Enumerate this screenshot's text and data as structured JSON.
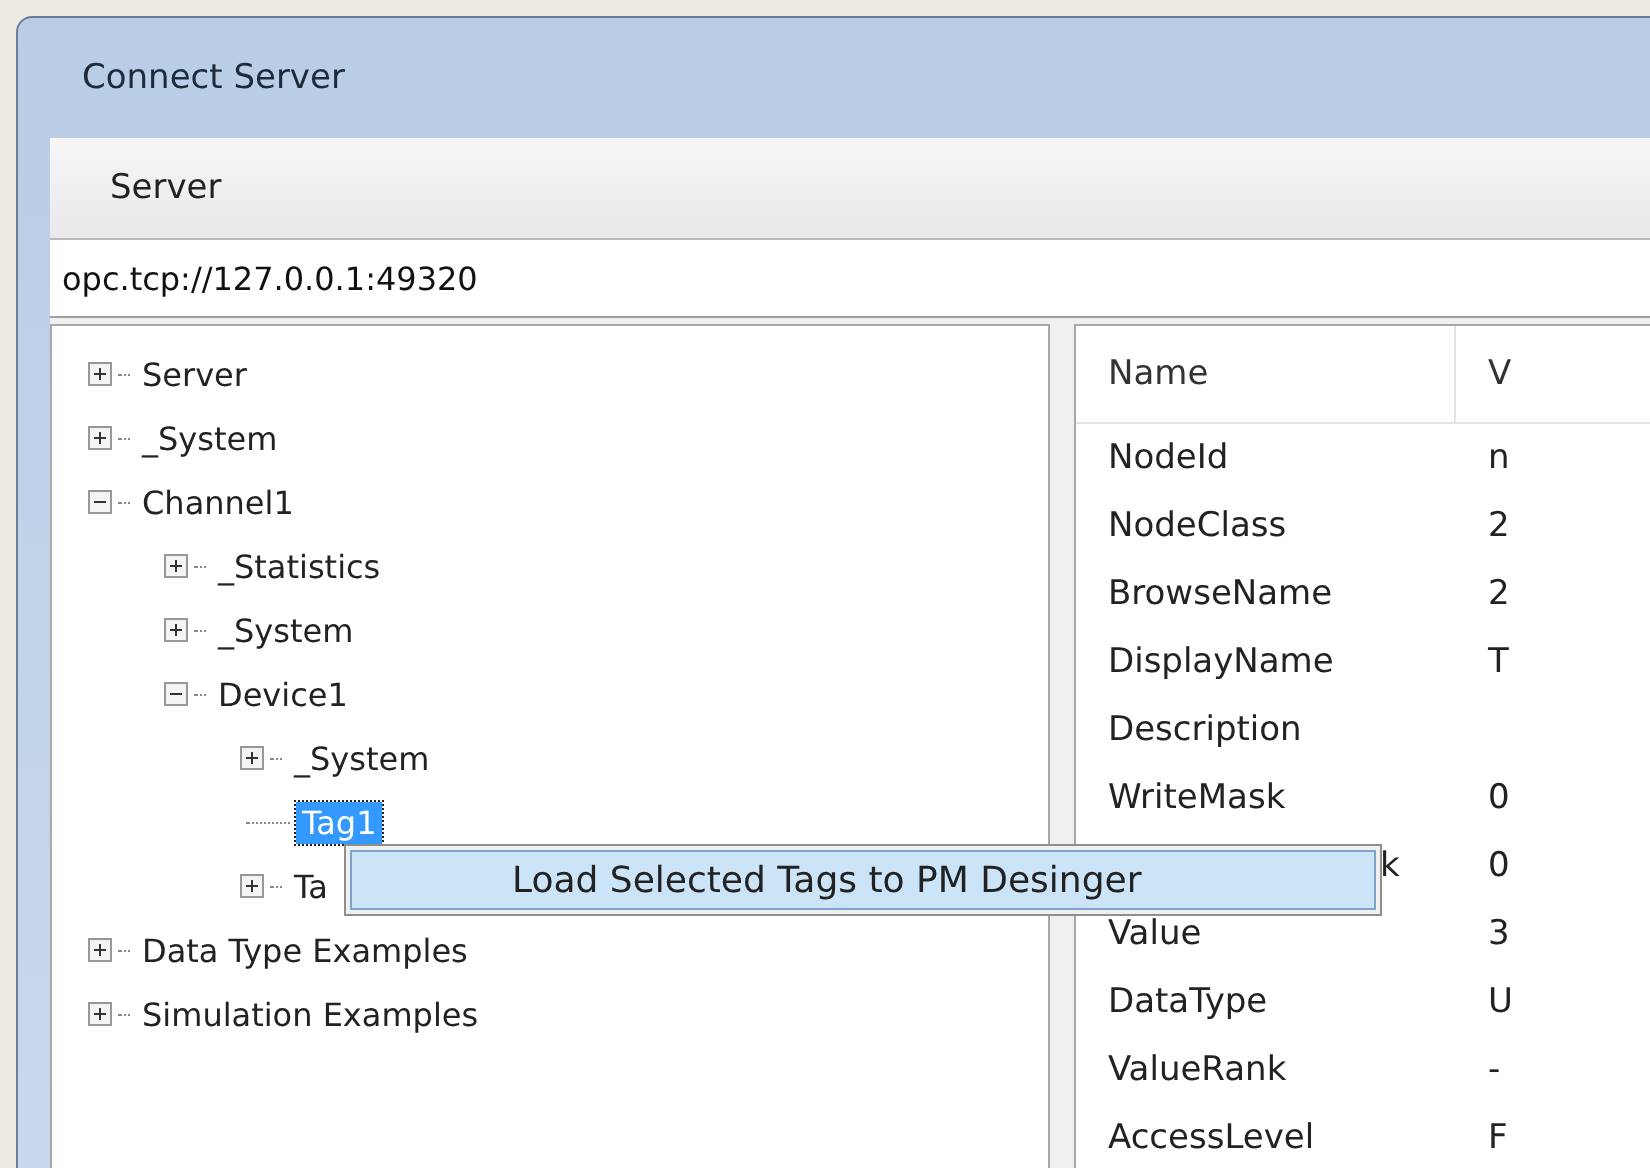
{
  "window": {
    "title": "Connect Server"
  },
  "menu": [
    {
      "label": "Server"
    }
  ],
  "address": {
    "value": "opc.tcp://127.0.0.1:49320"
  },
  "tree": [
    {
      "label": "Server",
      "kind": "folder",
      "expanded": false,
      "selected": false
    },
    {
      "label": "_System",
      "kind": "folder",
      "expanded": false,
      "selected": false
    },
    {
      "label": "Channel1",
      "kind": "folder",
      "expanded": true,
      "selected": false,
      "children": [
        {
          "label": "_Statistics",
          "kind": "folder",
          "expanded": false,
          "selected": false
        },
        {
          "label": "_System",
          "kind": "folder",
          "expanded": false,
          "selected": false
        },
        {
          "label": "Device1",
          "kind": "folder",
          "expanded": true,
          "selected": false,
          "children": [
            {
              "label": "_System",
              "kind": "folder",
              "expanded": false,
              "selected": false
            },
            {
              "label": "Tag1",
              "kind": "leaf",
              "selected": true
            },
            {
              "label": "Ta",
              "kind": "folder",
              "expanded": false,
              "selected": false
            }
          ]
        }
      ]
    },
    {
      "label": "Data Type Examples",
      "kind": "folder",
      "expanded": false,
      "selected": false
    },
    {
      "label": "Simulation Examples",
      "kind": "folder",
      "expanded": false,
      "selected": false
    }
  ],
  "properties": {
    "columns": [
      "Name",
      "V"
    ],
    "rows": [
      [
        "NodeId",
        "n"
      ],
      [
        "NodeClass",
        "2"
      ],
      [
        "BrowseName",
        "2"
      ],
      [
        "DisplayName",
        "T"
      ],
      [
        "Description",
        ""
      ],
      [
        "WriteMask",
        "0"
      ],
      [
        "k",
        "0"
      ],
      [
        "Value",
        "3"
      ],
      [
        "DataType",
        "U"
      ],
      [
        "ValueRank",
        "-"
      ],
      [
        "AccessLevel",
        "F"
      ]
    ]
  },
  "context_menu": {
    "items": [
      {
        "label": "Load Selected Tags to PM Desinger"
      }
    ]
  }
}
